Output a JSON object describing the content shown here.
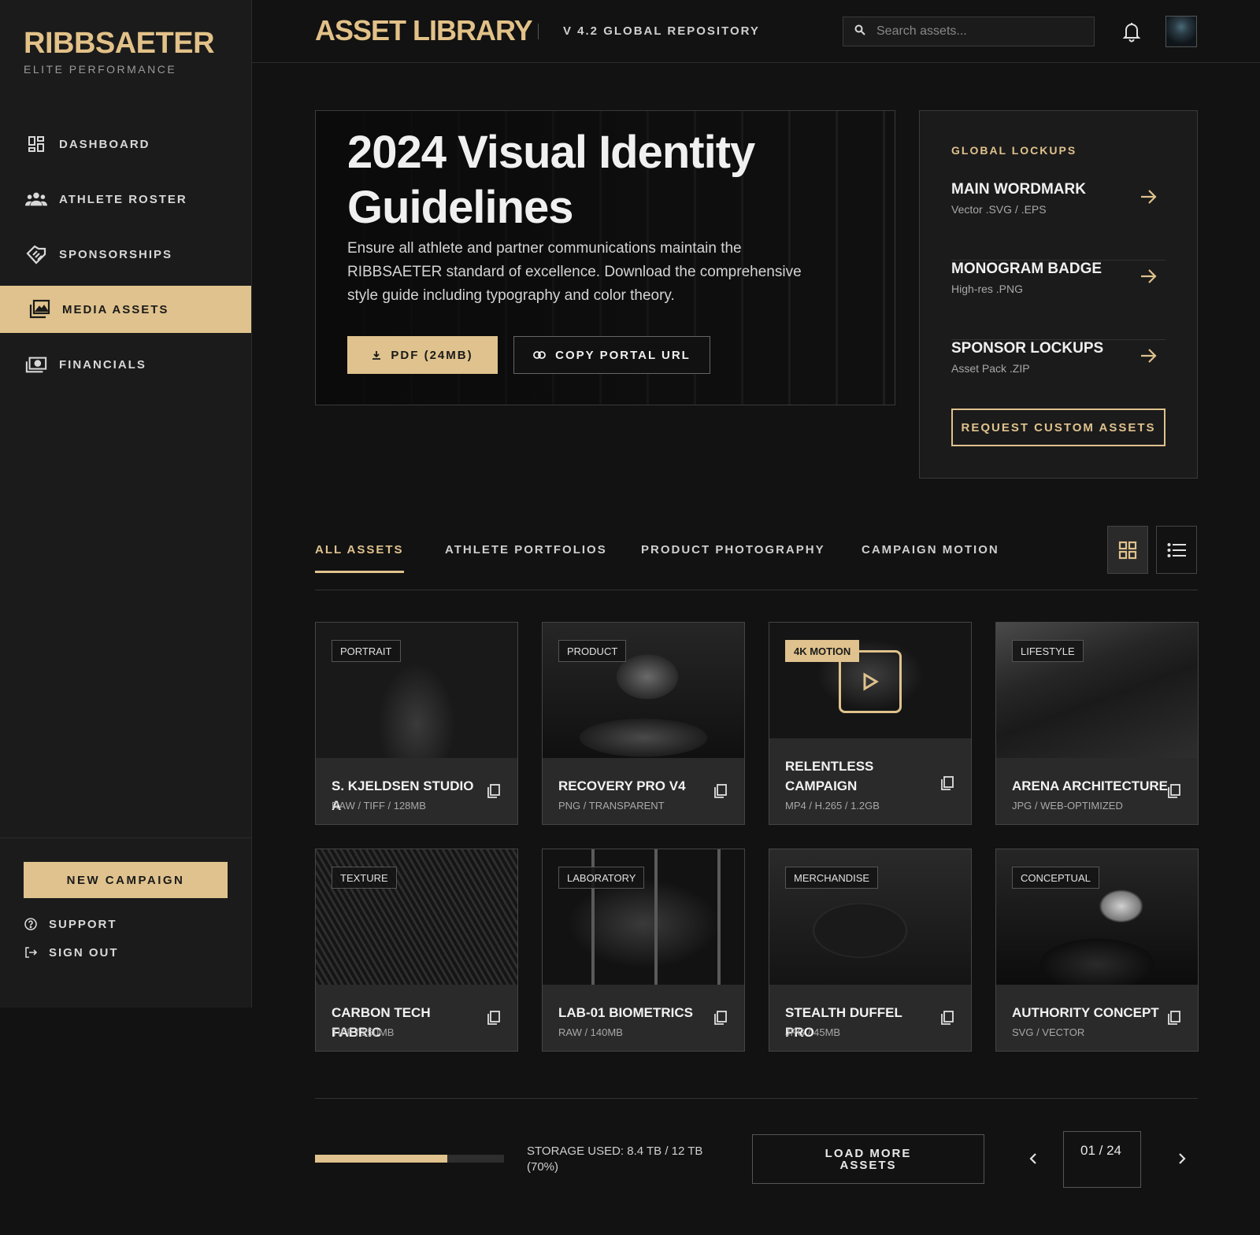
{
  "brand": {
    "name": "RIBBSAETER",
    "tagline": "ELITE PERFORMANCE"
  },
  "sidebar": {
    "items": [
      {
        "label": "DASHBOARD",
        "icon": "dashboard-icon",
        "active": false
      },
      {
        "label": "ATHLETE ROSTER",
        "icon": "group-icon",
        "active": false
      },
      {
        "label": "SPONSORSHIPS",
        "icon": "handshake-icon",
        "active": false
      },
      {
        "label": "MEDIA ASSETS",
        "icon": "photo-library-icon",
        "active": true
      },
      {
        "label": "FINANCIALS",
        "icon": "payments-icon",
        "active": false
      }
    ],
    "new_campaign": "NEW CAMPAIGN",
    "support": "SUPPORT",
    "sign_out": "SIGN OUT"
  },
  "header": {
    "title": "ASSET LIBRARY",
    "subtitle": "V 4.2 GLOBAL REPOSITORY",
    "search_placeholder": "Search assets..."
  },
  "hero": {
    "title": "2024 Visual Identity Guidelines",
    "description": "Ensure all athlete and partner communications maintain the RIBBSAETER standard of excellence. Download the comprehensive style guide including typography and color theory.",
    "pdf_button": "PDF (24MB)",
    "copy_button": "COPY PORTAL URL"
  },
  "lockups": {
    "heading": "GLOBAL LOCKUPS",
    "items": [
      {
        "title": "MAIN WORDMARK",
        "subtitle": "Vector .SVG / .EPS"
      },
      {
        "title": "MONOGRAM BADGE",
        "subtitle": "High-res .PNG"
      },
      {
        "title": "SPONSOR LOCKUPS",
        "subtitle": "Asset Pack .ZIP"
      }
    ],
    "request_button": "REQUEST CUSTOM ASSETS"
  },
  "tabs": [
    {
      "label": "ALL ASSETS",
      "active": true
    },
    {
      "label": "ATHLETE PORTFOLIOS",
      "active": false
    },
    {
      "label": "PRODUCT PHOTOGRAPHY",
      "active": false
    },
    {
      "label": "CAMPAIGN MOTION",
      "active": false
    }
  ],
  "view_mode": "grid",
  "assets": [
    {
      "badge": "PORTRAIT",
      "title": "S. KJELDSEN STUDIO A",
      "meta": "RAW / TIFF / 128MB"
    },
    {
      "badge": "PRODUCT",
      "title": "RECOVERY PRO V4",
      "meta": "PNG / TRANSPARENT"
    },
    {
      "badge": "4K MOTION",
      "title": "RELENTLESS CAMPAIGN",
      "meta": "MP4 / H.265 / 1.2GB"
    },
    {
      "badge": "LIFESTYLE",
      "title": "ARENA ARCHITECTURE",
      "meta": "JPG / WEB-OPTIMIZED"
    },
    {
      "badge": "TEXTURE",
      "title": "CARBON TECH FABRIC",
      "meta": "TIFF / 250MB"
    },
    {
      "badge": "LABORATORY",
      "title": "LAB-01 BIOMETRICS",
      "meta": "RAW / 140MB"
    },
    {
      "badge": "MERCHANDISE",
      "title": "STEALTH DUFFEL PRO",
      "meta": "JPG / 45MB"
    },
    {
      "badge": "CONCEPTUAL",
      "title": "AUTHORITY CONCEPT",
      "meta": "SVG / VECTOR"
    }
  ],
  "footer": {
    "storage_text": "STORAGE USED: 8.4 TB / 12 TB (70%)",
    "storage_fraction": 0.7,
    "load_more": "LOAD MORE ASSETS",
    "page_indicator": "01 / 24"
  },
  "colors": {
    "accent": "#dfc28d",
    "background": "#121212",
    "panel": "#1b1b1b"
  }
}
